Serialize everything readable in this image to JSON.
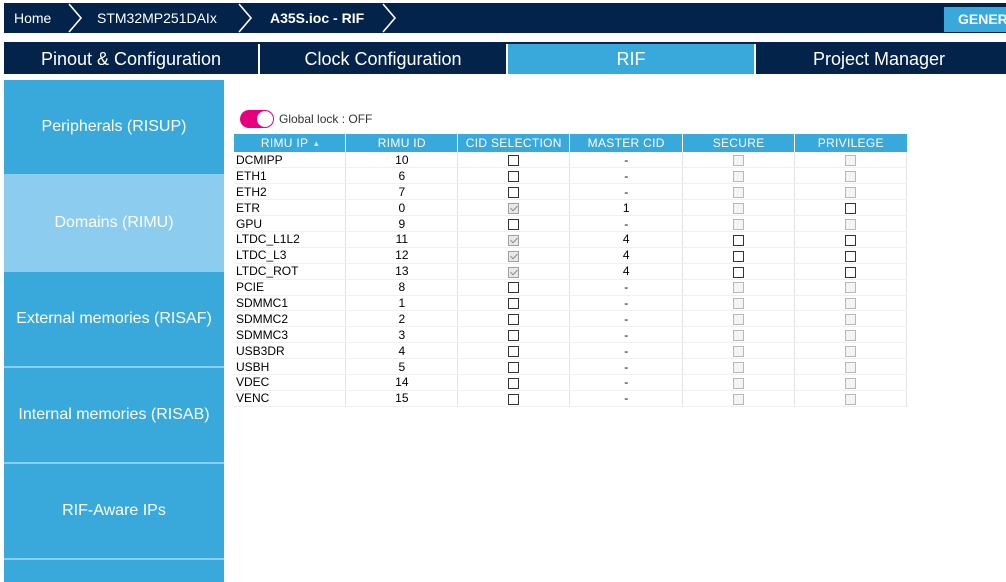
{
  "breadcrumb": {
    "items": [
      "Home",
      "STM32MP251DAIx",
      "A35S.ioc - RIF"
    ],
    "generate_label": "GENERATE CODE"
  },
  "tabs": [
    {
      "label": "Pinout & Configuration",
      "active": false
    },
    {
      "label": "Clock Configuration",
      "active": false
    },
    {
      "label": "RIF",
      "active": true
    },
    {
      "label": "Project Manager",
      "active": false
    }
  ],
  "sidebar": {
    "items": [
      {
        "label": "Peripherals (RISUP)",
        "active": false
      },
      {
        "label": "Domains (RIMU)",
        "active": true
      },
      {
        "label": "External memories (RISAF)",
        "active": false
      },
      {
        "label": "Internal memories (RISAB)",
        "active": false
      },
      {
        "label": "RIF-Aware IPs",
        "active": false
      }
    ]
  },
  "global_lock": {
    "label": "Global lock : OFF",
    "state": "off"
  },
  "table": {
    "columns": [
      "RIMU IP",
      "RIMU ID",
      "CID SELECTION",
      "MASTER CID",
      "SECURE",
      "PRIVILEGE"
    ],
    "rows": [
      {
        "ip": "DCMIPP",
        "id": "10",
        "cid_selection": "unchecked",
        "master_cid": "-",
        "secure": "disabled",
        "privilege": "disabled"
      },
      {
        "ip": "ETH1",
        "id": "6",
        "cid_selection": "unchecked",
        "master_cid": "-",
        "secure": "disabled",
        "privilege": "disabled"
      },
      {
        "ip": "ETH2",
        "id": "7",
        "cid_selection": "unchecked",
        "master_cid": "-",
        "secure": "disabled",
        "privilege": "disabled"
      },
      {
        "ip": "ETR",
        "id": "0",
        "cid_selection": "checked",
        "master_cid": "1",
        "secure": "disabled",
        "privilege": "unchecked"
      },
      {
        "ip": "GPU",
        "id": "9",
        "cid_selection": "unchecked",
        "master_cid": "-",
        "secure": "disabled",
        "privilege": "disabled"
      },
      {
        "ip": "LTDC_L1L2",
        "id": "11",
        "cid_selection": "checked",
        "master_cid": "4",
        "secure": "unchecked",
        "privilege": "unchecked"
      },
      {
        "ip": "LTDC_L3",
        "id": "12",
        "cid_selection": "checked",
        "master_cid": "4",
        "secure": "unchecked",
        "privilege": "unchecked"
      },
      {
        "ip": "LTDC_ROT",
        "id": "13",
        "cid_selection": "checked",
        "master_cid": "4",
        "secure": "unchecked",
        "privilege": "unchecked"
      },
      {
        "ip": "PCIE",
        "id": "8",
        "cid_selection": "unchecked",
        "master_cid": "-",
        "secure": "disabled",
        "privilege": "disabled"
      },
      {
        "ip": "SDMMC1",
        "id": "1",
        "cid_selection": "unchecked",
        "master_cid": "-",
        "secure": "disabled",
        "privilege": "disabled"
      },
      {
        "ip": "SDMMC2",
        "id": "2",
        "cid_selection": "unchecked",
        "master_cid": "-",
        "secure": "disabled",
        "privilege": "disabled"
      },
      {
        "ip": "SDMMC3",
        "id": "3",
        "cid_selection": "unchecked",
        "master_cid": "-",
        "secure": "disabled",
        "privilege": "disabled"
      },
      {
        "ip": "USB3DR",
        "id": "4",
        "cid_selection": "unchecked",
        "master_cid": "-",
        "secure": "disabled",
        "privilege": "disabled"
      },
      {
        "ip": "USBH",
        "id": "5",
        "cid_selection": "unchecked",
        "master_cid": "-",
        "secure": "disabled",
        "privilege": "disabled"
      },
      {
        "ip": "VDEC",
        "id": "14",
        "cid_selection": "unchecked",
        "master_cid": "-",
        "secure": "disabled",
        "privilege": "disabled"
      },
      {
        "ip": "VENC",
        "id": "15",
        "cid_selection": "unchecked",
        "master_cid": "-",
        "secure": "disabled",
        "privilege": "disabled"
      }
    ]
  },
  "colors": {
    "dark_navy": "#03234b",
    "accent_blue": "#39a9dc",
    "light_blue": "#8ccdef",
    "toggle_pink": "#e6007e"
  }
}
